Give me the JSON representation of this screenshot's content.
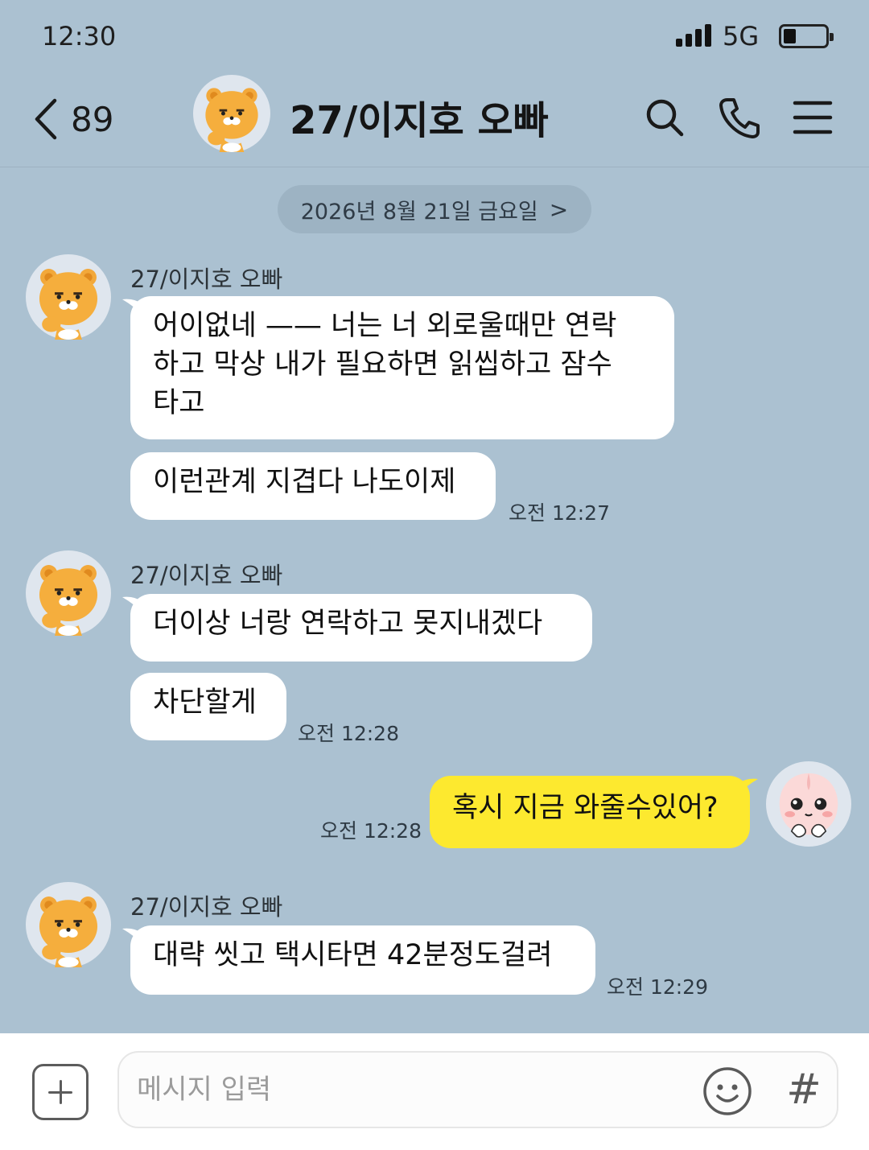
{
  "status": {
    "time": "12:30",
    "network": "5G",
    "battery_level": 0.3
  },
  "header": {
    "back_count": "89",
    "title": "27/이지호 오빠"
  },
  "date_divider": {
    "text": "2026년 8월 21일 금요일",
    "chevron": ">"
  },
  "messages": [
    {
      "sender": "27/이지호 오빠",
      "bubbles": [
        {
          "lines": [
            "어이없네 —— 너는 너 외로울때만 연락",
            "하고 막상 내가 필요하면 읽씹하고 잠수",
            "타고"
          ]
        },
        {
          "lines": [
            "이런관계 지겹다 나도이제"
          ],
          "time": "오전 12:27"
        }
      ]
    },
    {
      "sender": "27/이지호 오빠",
      "bubbles": [
        {
          "lines": [
            "더이상 너랑 연락하고 못지내겠다"
          ]
        },
        {
          "lines": [
            "차단할게"
          ],
          "time": "오전 12:28"
        }
      ]
    },
    {
      "sender": "me",
      "bubbles": [
        {
          "lines": [
            "혹시 지금 와줄수있어?"
          ],
          "time": "오전 12:28"
        }
      ]
    },
    {
      "sender": "27/이지호 오빠",
      "bubbles": [
        {
          "lines": [
            "대략 씻고 택시타면 42분정도걸려"
          ],
          "time": "오전 12:29"
        }
      ]
    }
  ],
  "input": {
    "placeholder": "메시지 입력",
    "hash": "#"
  },
  "icons": {
    "search": "search-icon",
    "call": "phone-icon",
    "menu": "menu-icon",
    "emoji": "emoji-icon",
    "plus": "plus-icon"
  },
  "colors": {
    "background": "#abc1d1",
    "my_bubble": "#fde92f",
    "other_bubble": "#ffffff"
  }
}
